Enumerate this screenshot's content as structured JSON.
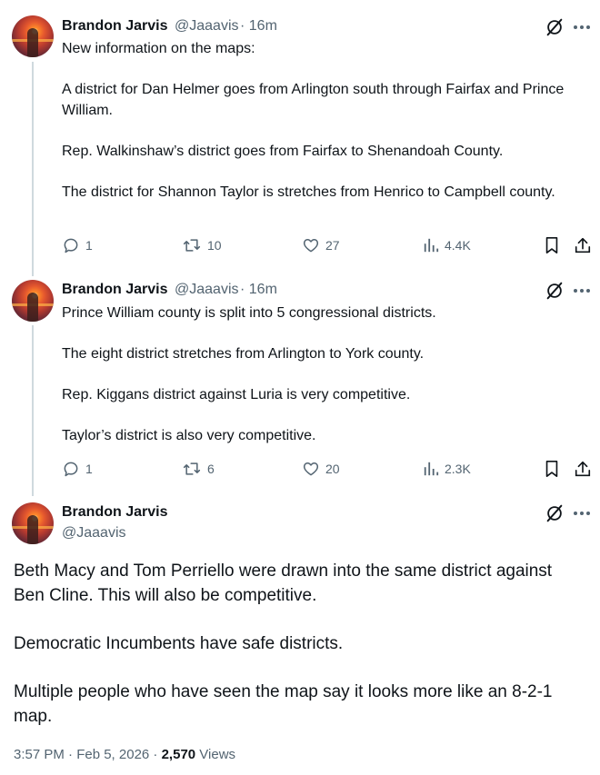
{
  "tweets": [
    {
      "name": "Brandon Jarvis",
      "handle": "@Jaaavis",
      "time": "· 16m",
      "paragraphs": [
        "New information on the maps:",
        "A district for Dan Helmer goes from Arlington south through Fairfax and Prince William.",
        "Rep. Walkinshaw’s district goes from Fairfax to Shenandoah County.",
        "The district for Shannon Taylor is stretches from Henrico to Campbell county."
      ],
      "replies": "1",
      "reposts": "10",
      "likes": "27",
      "views": "4.4K"
    },
    {
      "name": "Brandon Jarvis",
      "handle": "@Jaaavis",
      "time": "· 16m",
      "paragraphs": [
        "Prince William county is split into 5 congressional districts.",
        "The eight district  stretches from Arlington to York county.",
        "Rep. Kiggans district against Luria is very competitive.",
        "Taylor’s district is also very competitive."
      ],
      "replies": "1",
      "reposts": "6",
      "likes": "20",
      "views": "2.3K"
    }
  ],
  "main_tweet": {
    "name": "Brandon Jarvis",
    "handle": "@Jaaavis",
    "paragraphs": [
      "Beth Macy and Tom Perriello were drawn into the same district against Ben Cline. This will also be competitive.",
      "Democratic Incumbents have safe districts.",
      "Multiple people who have seen the map say it looks more like an 8-2-1 map."
    ],
    "timestamp": "3:57 PM · Feb 5, 2026 · ",
    "views_count": "2,570",
    "views_label": " Views"
  },
  "icons": {
    "grok": "grok-icon",
    "more": "more-dots-icon",
    "reply": "reply-icon",
    "repost": "repost-icon",
    "like": "like-icon",
    "views": "views-icon",
    "bookmark": "bookmark-icon",
    "share": "share-icon"
  },
  "colors": {
    "text": "#0f1419",
    "secondary": "#536471",
    "thread_line": "#cfd9de"
  }
}
